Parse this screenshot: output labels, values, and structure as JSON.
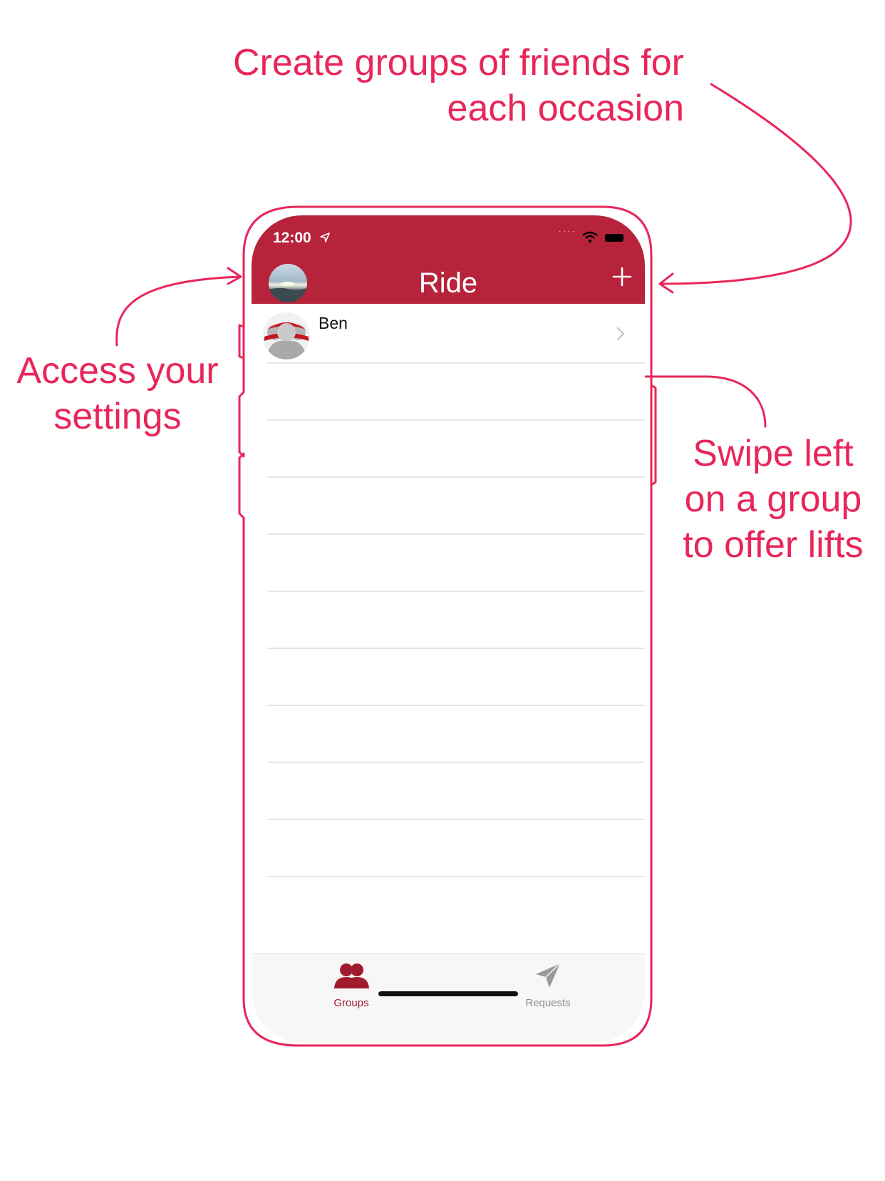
{
  "callouts": {
    "top_line1": "Create groups of friends for",
    "top_line2": "each occasion",
    "left_line1": "Access your",
    "left_line2": "settings",
    "right_line1": "Swipe left",
    "right_line2": "on a group",
    "right_line3": "to offer lifts"
  },
  "status_bar": {
    "time": "12:00"
  },
  "navbar": {
    "title": "Ride",
    "add_label": "+"
  },
  "groups": [
    {
      "name": "Ben"
    }
  ],
  "tabbar": {
    "items": [
      {
        "label": "Groups",
        "active": true
      },
      {
        "label": "Requests",
        "active": false
      }
    ]
  },
  "colors": {
    "navbar": "#b6233b",
    "annotation": "#e8265a",
    "tab_active": "#a01b2e",
    "tab_inactive": "#8e8e8e"
  },
  "icons": {
    "status_location": "location-arrow-icon",
    "status_wifi": "wifi-icon",
    "status_battery": "battery-icon",
    "nav_avatar": "profile-photo",
    "nav_add": "plus-icon",
    "group_avatar": "group-people-icon",
    "row_chevron": "chevron-right-icon",
    "tab_groups": "people-icon",
    "tab_requests": "paper-plane-icon"
  }
}
